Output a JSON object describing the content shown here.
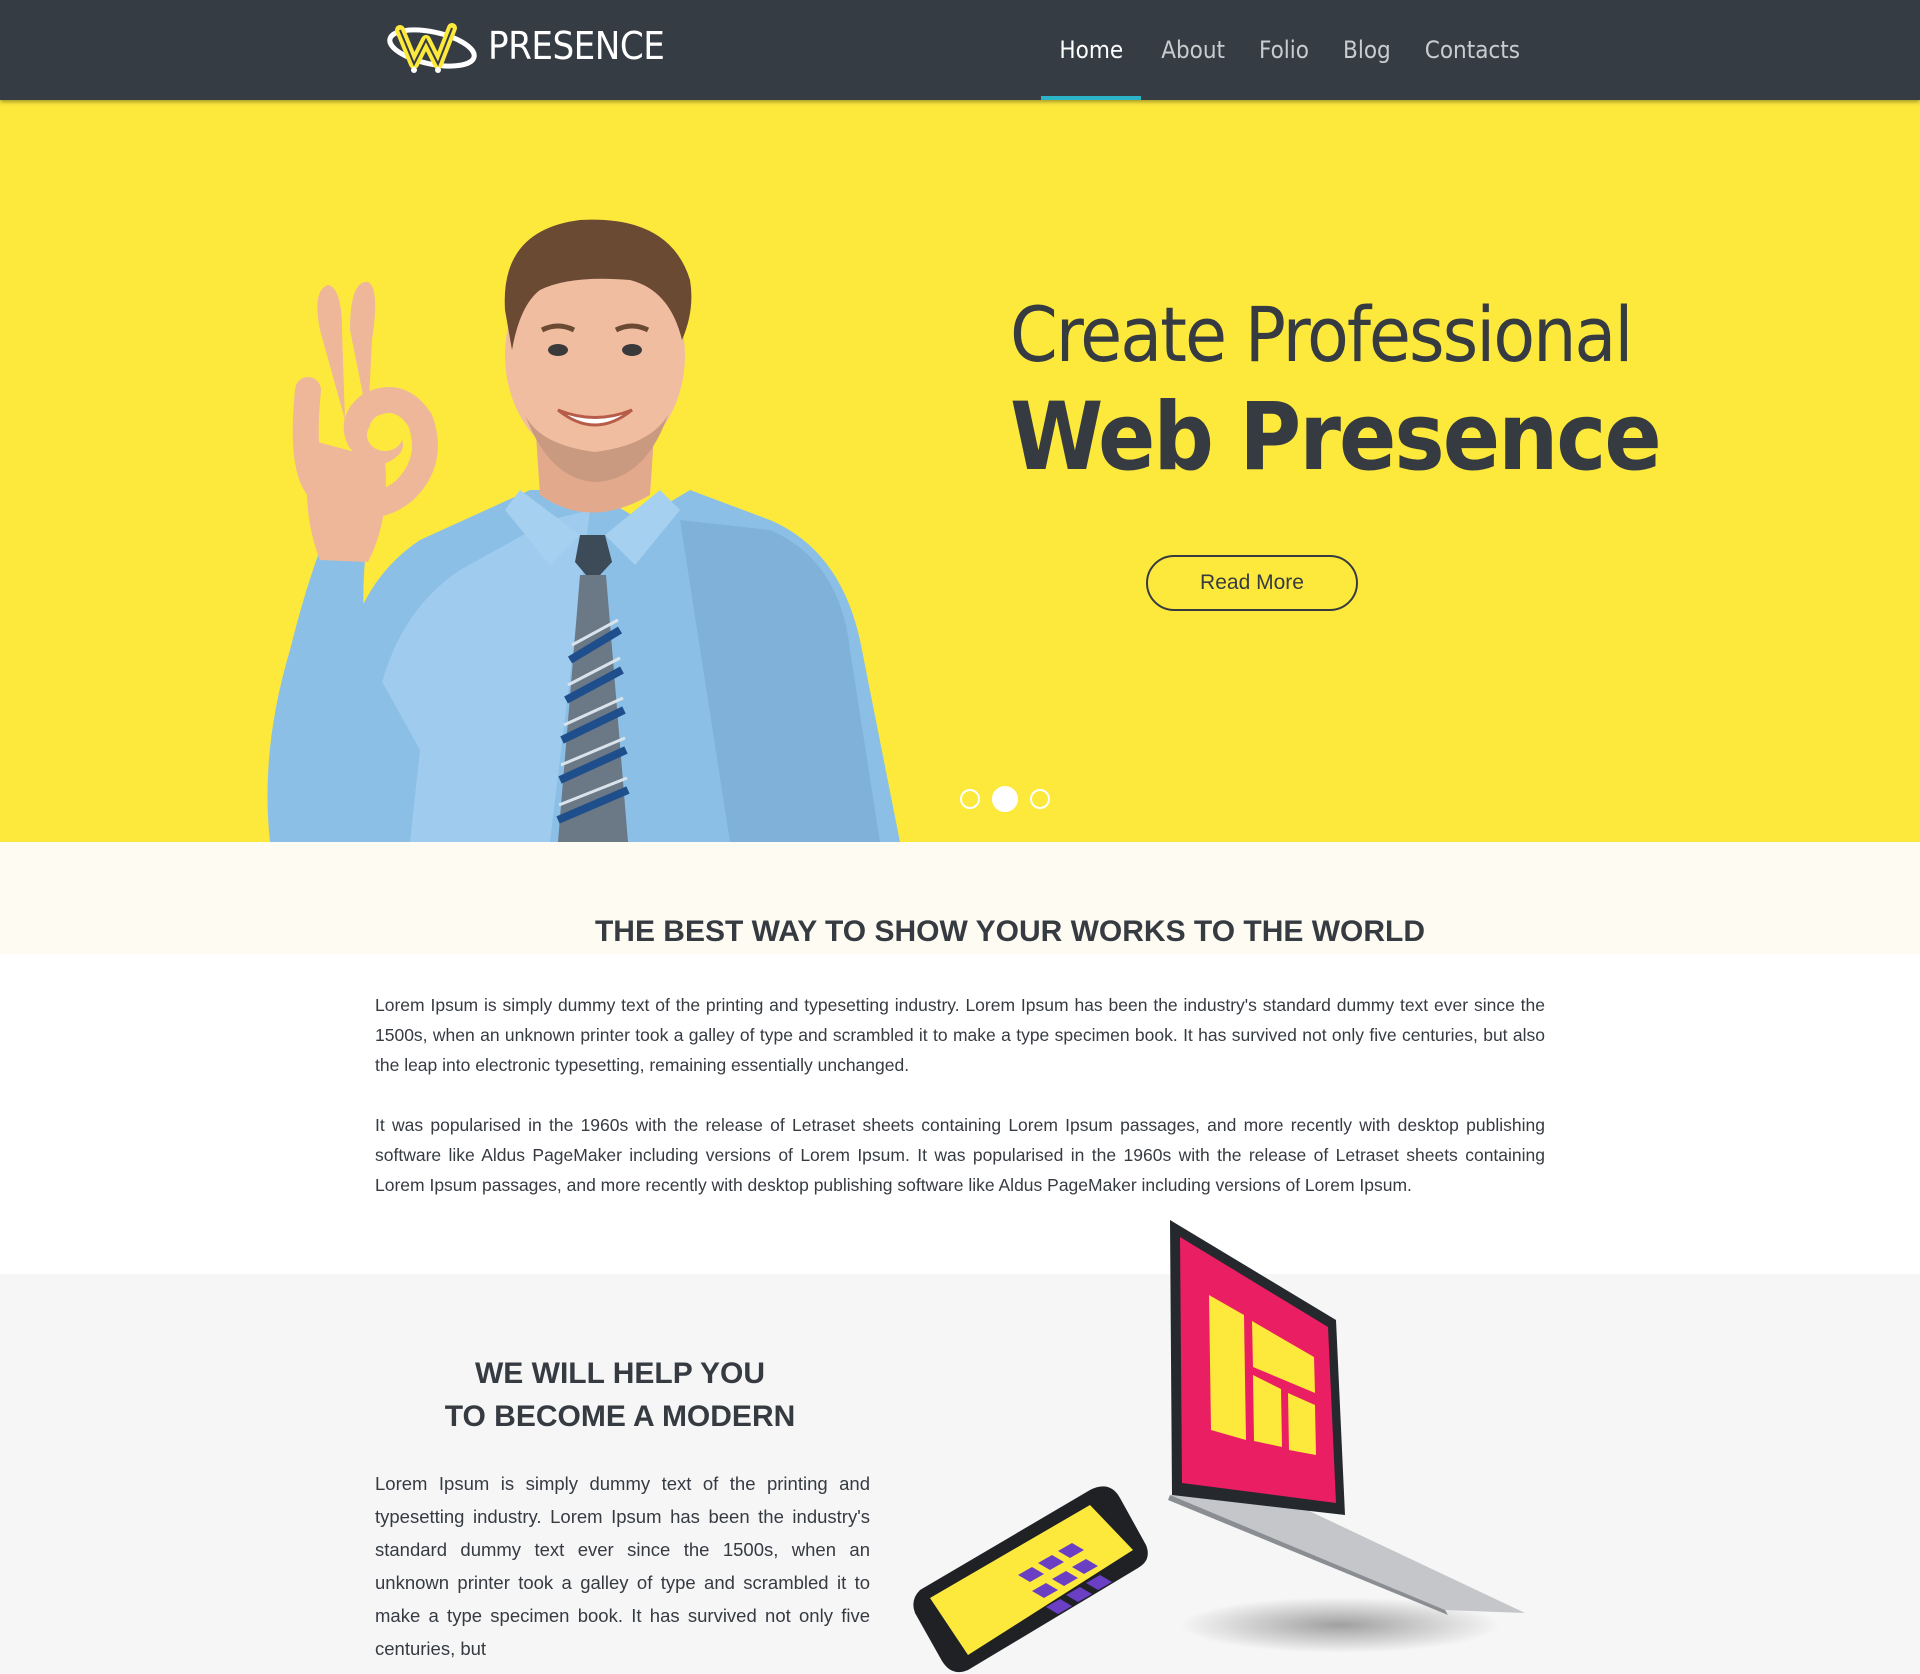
{
  "header": {
    "brand": "PRESENCE",
    "nav": [
      {
        "label": "Home",
        "active": true
      },
      {
        "label": "About",
        "active": false
      },
      {
        "label": "Folio",
        "active": false
      },
      {
        "label": "Blog",
        "active": false
      },
      {
        "label": "Contacts",
        "active": false
      }
    ]
  },
  "hero": {
    "line1": "Create Professional",
    "line2": "Web Presence",
    "button": "Read More",
    "slides": 3,
    "active_slide": 2
  },
  "intro": {
    "title": "THE BEST WAY TO SHOW YOUR WORKS TO THE WORLD",
    "paragraph1": "Lorem Ipsum is simply dummy text of the printing and typesetting industry. Lorem Ipsum has been the industry's standard dummy text ever since the 1500s, when an unknown printer took a galley of type and scrambled it to make a type specimen book. It has survived not only five centuries, but also the leap into electronic typesetting, remaining essentially unchanged.",
    "paragraph2": " It was popularised in the 1960s with the release of Letraset sheets containing Lorem Ipsum passages, and more recently with desktop publishing software like Aldus PageMaker including versions of Lorem Ipsum.  It was popularised in the 1960s with the release of Letraset sheets containing Lorem Ipsum passages, and more recently with desktop publishing software like Aldus PageMaker including versions of Lorem Ipsum."
  },
  "feature": {
    "title_line1": "WE WILL HELP YOU",
    "title_line2": "TO BECOME A MODERN",
    "paragraph": "Lorem Ipsum is simply dummy text of the printing and typesetting industry. Lorem Ipsum has been the industry's standard dummy text ever since the 1500s, when an unknown printer took a galley of type and scrambled it to make a type specimen book. It has survived not only five centuries, but"
  },
  "colors": {
    "header_bg": "#353c43",
    "accent": "#2bb3c8",
    "hero_bg": "#fde93c",
    "text": "#363b42",
    "laptop_screen": "#e91e63",
    "yellow": "#fde93c",
    "purple": "#6a3fc4"
  }
}
